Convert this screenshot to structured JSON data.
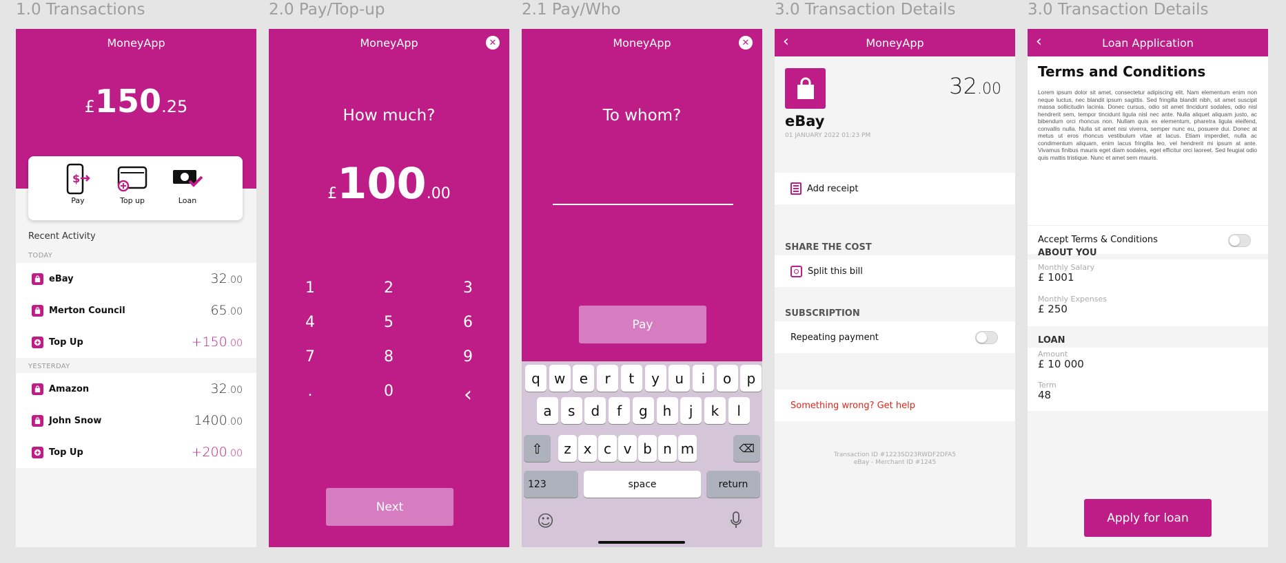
{
  "labels": [
    "1.0 Transactions",
    "2.0 Pay/Top-up",
    "2.1 Pay/Who",
    "3.0 Transaction Details",
    "3.0 Transaction Details"
  ],
  "brand": "MoneyApp",
  "colors": {
    "accent": "#be1d88",
    "button_light": "#d67cc0",
    "link_red": "#e2231a"
  },
  "s1": {
    "currency": "£",
    "balance_int": "150",
    "balance_dec": ".25",
    "actions": [
      {
        "label": "Pay",
        "icon": "pay-phone-icon"
      },
      {
        "label": "Top up",
        "icon": "wallet-icon"
      },
      {
        "label": "Loan",
        "icon": "loan-cash-icon"
      }
    ],
    "recent_title": "Recent Activity",
    "today": "TODAY",
    "yesterday": "YESTERDAY",
    "today_items": [
      {
        "name": "eBay",
        "int": "32",
        "dec": ".00",
        "type": "debit"
      },
      {
        "name": "Merton Council",
        "int": "65",
        "dec": ".00",
        "type": "debit"
      },
      {
        "name": "Top Up",
        "int": "+150",
        "dec": ".00",
        "type": "credit"
      }
    ],
    "yesterday_items": [
      {
        "name": "Amazon",
        "int": "32",
        "dec": ".00",
        "type": "debit"
      },
      {
        "name": "John Snow",
        "int": "1400",
        "dec": ".00",
        "type": "debit"
      },
      {
        "name": "Top Up",
        "int": "+200",
        "dec": ".00",
        "type": "credit"
      }
    ]
  },
  "s2": {
    "question": "How much?",
    "currency": "£",
    "amount_int": "100",
    "amount_dec": ".00",
    "keys": [
      "1",
      "2",
      "3",
      "4",
      "5",
      "6",
      "7",
      "8",
      "9",
      ".",
      "0",
      "‹"
    ],
    "next": "Next"
  },
  "s3": {
    "question": "To whom?",
    "pay": "Pay",
    "row1": [
      "q",
      "w",
      "e",
      "r",
      "t",
      "y",
      "u",
      "i",
      "o",
      "p"
    ],
    "row2": [
      "a",
      "s",
      "d",
      "f",
      "g",
      "h",
      "j",
      "k",
      "l"
    ],
    "row3": [
      "z",
      "x",
      "c",
      "v",
      "b",
      "n",
      "m"
    ],
    "k123": "123",
    "space": "space",
    "return": "return"
  },
  "s4": {
    "amount_int": "32",
    "amount_dec": ".00",
    "merchant": "eBay",
    "date": "01 JANUARY 2022 01:23 PM",
    "add_receipt": "Add receipt",
    "share_cost": "SHARE THE COST",
    "split": "Split this bill",
    "subscription": "SUBSCRIPTION",
    "repeating": "Repeating payment",
    "help": "Something wrong? Get help",
    "txn_id": "Transaction ID #1223SD23RWDF2DFA5",
    "merchant_id": "eBay - Merchant ID #1245"
  },
  "s5": {
    "title": "Loan Application",
    "heading": "Terms and Conditions",
    "body": "Lorem ipsum dolor sit amet, consectetur adipiscing elit. Nam elementum enim non neque luctus, nec blandit ipsum sagittis. Sed fringilla blandit nibh, sit amet suscipit massa sollicitudin lacinia. Donec cursus, odio sit amet tincidunt sodales, odio nisl hendrerit sem, tempor tincidunt ligula nisl nec ante. Nulla aliquet aliquam justo, ac bibendum orci rhoncus non. Nullam quis ex elementum, pharetra ligula eleifend, convallis nulla. Nulla sit amet nisi viverra, semper nunc eu, posuere dui. Donec at metus ut eros rhoncus vestibulum vitae at lacus. Etiam imperdiet, nulla ac condimentum aliquam, enim lacus fringilla leo, vel hendrerit mi ipsum at ante. Vivamus finibus mauris eget diam sodales, eget efficitur orci laoreet. Sed feugiat odio quis mattis tristique. Nunc et amet sem mauris.",
    "accept": "Accept Terms & Conditions",
    "about": "ABOUT YOU",
    "salary_label": "Monthly Salary",
    "salary": "£ 1001",
    "expenses_label": "Monthly Expenses",
    "expenses": "£ 250",
    "loan": "LOAN",
    "amount_label": "Amount",
    "amount": "£ 10 000",
    "term_label": "Term",
    "term": "48",
    "apply": "Apply for loan"
  }
}
